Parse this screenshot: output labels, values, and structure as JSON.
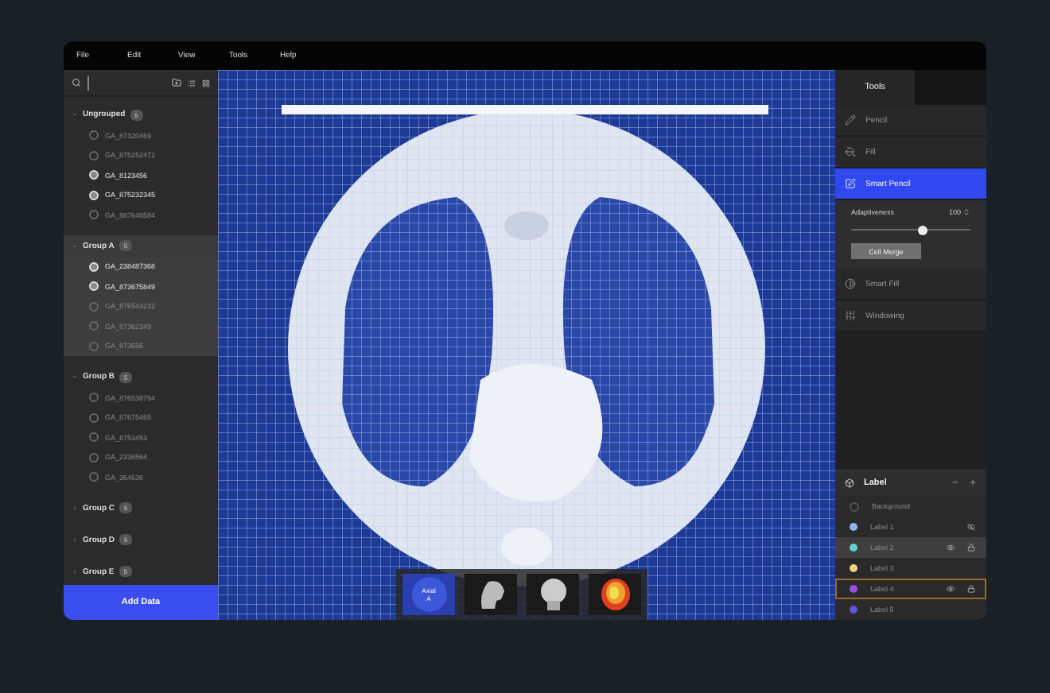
{
  "menu": [
    "File",
    "Edit",
    "View",
    "Tools",
    "Help"
  ],
  "groups": [
    {
      "name": "Ungrouped",
      "count": "5",
      "expanded": true,
      "highlighted": false,
      "items": [
        {
          "id": "GA_87320469",
          "selected": false
        },
        {
          "id": "GA_875252472",
          "selected": false
        },
        {
          "id": "GA_8123456",
          "selected": true
        },
        {
          "id": "GA_875232345",
          "selected": true
        },
        {
          "id": "GA_987646584",
          "selected": false
        }
      ]
    },
    {
      "name": "Group A",
      "count": "5",
      "expanded": true,
      "highlighted": true,
      "items": [
        {
          "id": "GA_238487368",
          "selected": true
        },
        {
          "id": "GA_873675849",
          "selected": true
        },
        {
          "id": "GA_876543232",
          "selected": false
        },
        {
          "id": "GA_87362349",
          "selected": false
        },
        {
          "id": "GA_873656",
          "selected": false
        }
      ]
    },
    {
      "name": "Group B",
      "count": "5",
      "expanded": true,
      "highlighted": false,
      "items": [
        {
          "id": "GA_876538794",
          "selected": false
        },
        {
          "id": "GA_87675465",
          "selected": false
        },
        {
          "id": "GA_8753453",
          "selected": false
        },
        {
          "id": "GA_2336564",
          "selected": false
        },
        {
          "id": "GA_364636",
          "selected": false
        }
      ]
    },
    {
      "name": "Group C",
      "count": "5",
      "expanded": false,
      "highlighted": false
    },
    {
      "name": "Group D",
      "count": "5",
      "expanded": false,
      "highlighted": false
    },
    {
      "name": "Group E",
      "count": "5",
      "expanded": false,
      "highlighted": false
    }
  ],
  "add_button": "Add Data",
  "thumbnails": [
    {
      "kind": "axial",
      "label": "Axial",
      "sub": "A",
      "selected": true
    },
    {
      "kind": "sagittal",
      "selected": false
    },
    {
      "kind": "coronal",
      "selected": false
    },
    {
      "kind": "heatmap",
      "selected": false
    }
  ],
  "tools_tab": "Tools",
  "tools": [
    {
      "kind": "pencil",
      "label": "Pencil",
      "selected": false
    },
    {
      "kind": "fill",
      "label": "Fill",
      "selected": false
    },
    {
      "kind": "smart-pencil",
      "label": "Smart Pencil",
      "selected": true
    },
    {
      "kind": "smart-fill",
      "label": "Smart Fill",
      "selected": false
    },
    {
      "kind": "windowing",
      "label": "Windowing",
      "selected": false
    }
  ],
  "smart_options": {
    "label": "Adaptiveness",
    "value": "100",
    "level": 0.6,
    "button": "Cell Merge"
  },
  "labels_title": "Label",
  "labels": [
    {
      "name": "Background",
      "selected": false,
      "focused": false,
      "hidden": false,
      "locked": false,
      "visible": false
    },
    {
      "name": "Label 1",
      "color": "#8fb4f5",
      "selected": false,
      "focused": false,
      "hidden": true,
      "locked": false,
      "visible": false
    },
    {
      "name": "Label 2",
      "color": "#5fd0cc",
      "selected": true,
      "focused": false,
      "hidden": false,
      "locked": true,
      "visible": true
    },
    {
      "name": "Label 3",
      "color": "#f2d27c",
      "selected": false,
      "focused": false,
      "hidden": false,
      "locked": false,
      "visible": false
    },
    {
      "name": "Label 4",
      "color": "#a24be3",
      "selected": false,
      "focused": true,
      "hidden": false,
      "locked": true,
      "visible": true
    },
    {
      "name": "Label 5",
      "color": "#5b55d9",
      "selected": false,
      "focused": false,
      "hidden": false,
      "locked": false,
      "visible": false
    }
  ]
}
